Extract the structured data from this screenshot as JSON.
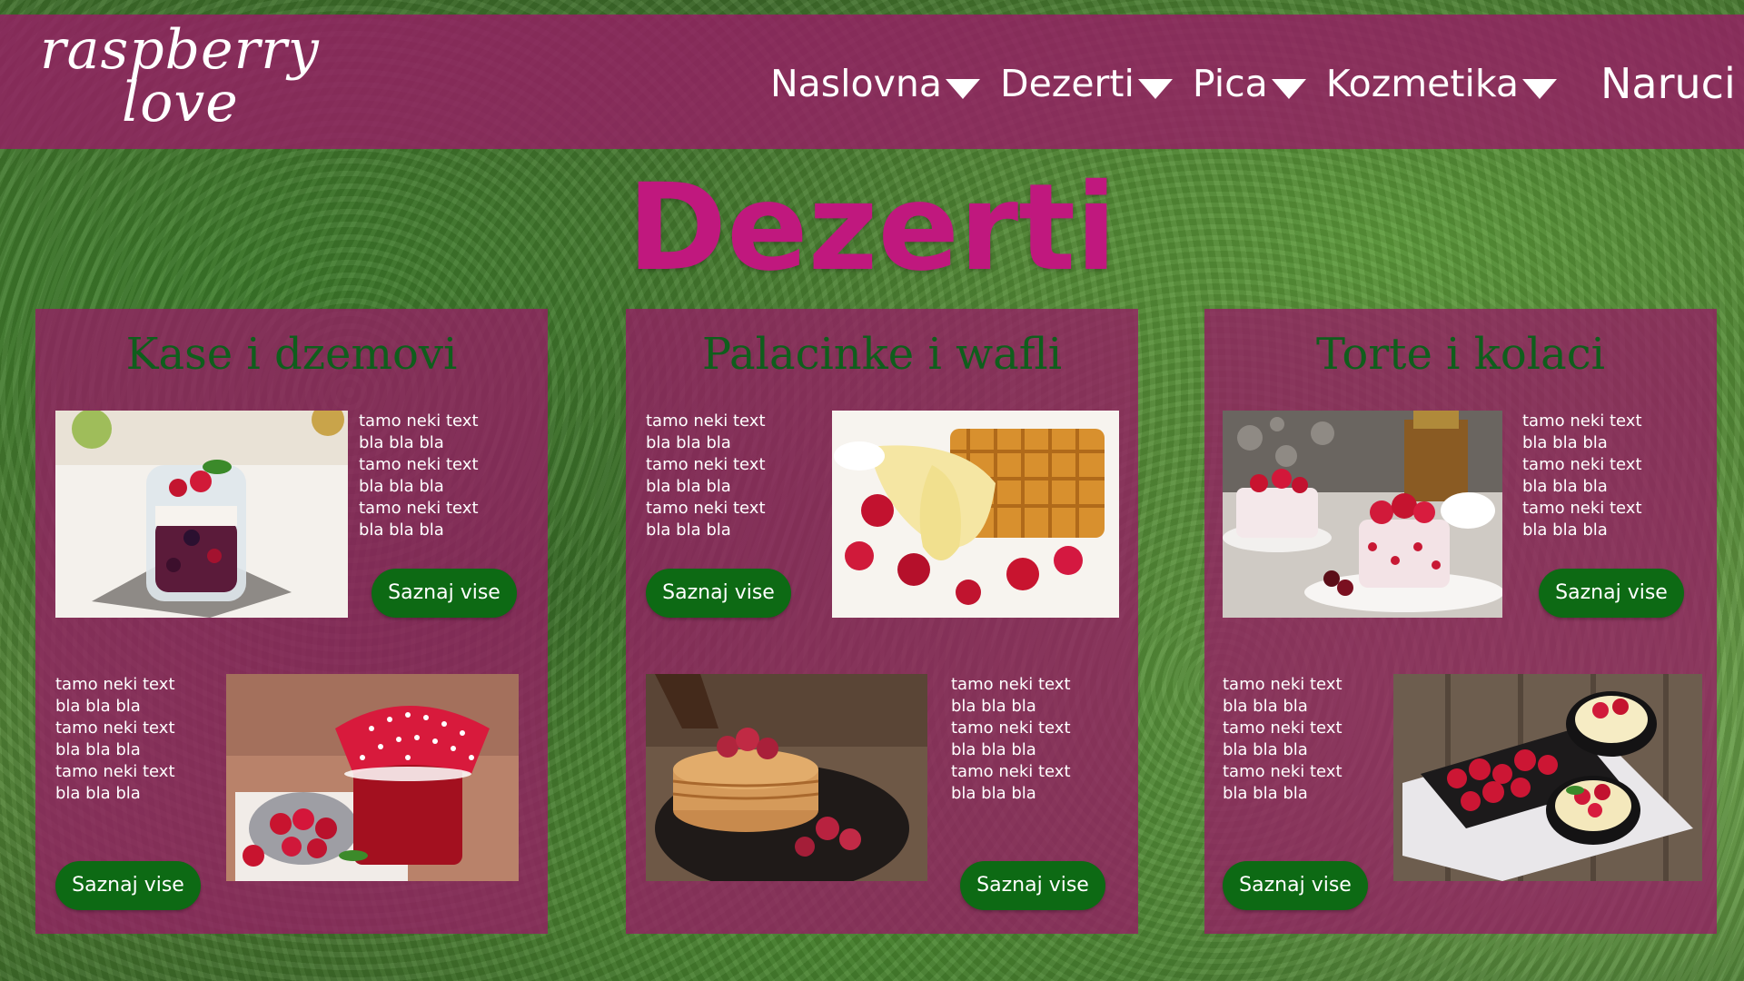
{
  "header": {
    "logo_line1": "raspberry",
    "logo_line2": "love",
    "nav": [
      {
        "label": "Naslovna"
      },
      {
        "label": "Dezerti"
      },
      {
        "label": "Pica"
      },
      {
        "label": "Kozmetika"
      },
      {
        "label": "Naruci"
      }
    ]
  },
  "page_title": "Dezerti",
  "categories": [
    {
      "title": "Kase i dzemovi",
      "items": [
        {
          "text": "tamo neki text\nbla bla bla\ntamo neki text\nbla bla bla\ntamo neki text\nbla bla bla",
          "button": "Saznaj vise",
          "image": "berry-jar-dessert-photo"
        },
        {
          "text": "tamo neki text\nbla bla bla\ntamo neki text\nbla bla bla\ntamo neki text\nbla bla bla",
          "button": "Saznaj vise",
          "image": "raspberry-jam-jar-photo"
        }
      ]
    },
    {
      "title": "Palacinke i wafli",
      "items": [
        {
          "text": "tamo neki text\nbla bla bla\ntamo neki text\nbla bla bla\ntamo neki text\nbla bla bla",
          "button": "Saznaj vise",
          "image": "waffles-raspberries-photo"
        },
        {
          "text": "tamo neki text\nbla bla bla\ntamo neki text\nbla bla bla\ntamo neki text\nbla bla bla",
          "button": "Saznaj vise",
          "image": "pancakes-syrup-photo"
        }
      ]
    },
    {
      "title": "Torte i kolaci",
      "items": [
        {
          "text": "tamo neki text\nbla bla bla\ntamo neki text\nbla bla bla\ntamo neki text\nbla bla bla",
          "button": "Saznaj vise",
          "image": "strawberry-cakes-photo"
        },
        {
          "text": "tamo neki text\nbla bla bla\ntamo neki text\nbla bla bla\ntamo neki text\nbla bla bla",
          "button": "Saznaj vise",
          "image": "raspberry-pudding-bowls-photo"
        }
      ]
    }
  ],
  "colors": {
    "header_bg": "#961e64",
    "title": "#c0187e",
    "category_title": "#0f5e1c",
    "button_bg": "#0d6a14"
  }
}
